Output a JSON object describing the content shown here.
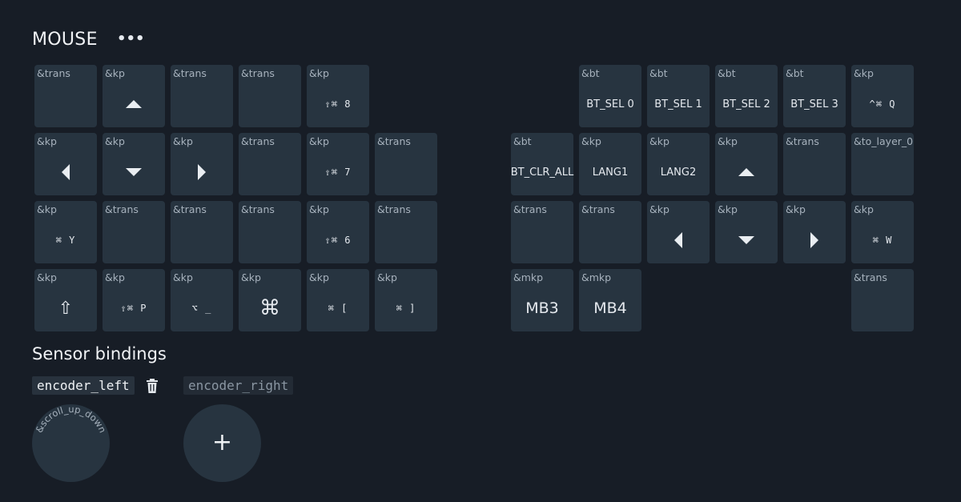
{
  "layer": {
    "name": "MOUSE",
    "menu_label": "•••"
  },
  "keys": [
    {
      "behavior": "&trans",
      "param": ""
    },
    {
      "behavior": "&kp",
      "param": "",
      "icon": "arrow-up-icon"
    },
    {
      "behavior": "&trans",
      "param": ""
    },
    {
      "behavior": "&trans",
      "param": ""
    },
    {
      "behavior": "&kp",
      "param": "⇧⌘ 8",
      "style": "mono"
    },
    {
      "behavior": "&bt",
      "param": "BT_SEL 0",
      "style": "sm"
    },
    {
      "behavior": "&bt",
      "param": "BT_SEL 1",
      "style": "sm"
    },
    {
      "behavior": "&bt",
      "param": "BT_SEL 2",
      "style": "sm"
    },
    {
      "behavior": "&bt",
      "param": "BT_SEL 3",
      "style": "sm"
    },
    {
      "behavior": "&kp",
      "param": "^⌘ Q",
      "style": "mono"
    },
    {
      "behavior": "&kp",
      "param": "",
      "icon": "arrow-left-icon"
    },
    {
      "behavior": "&kp",
      "param": "",
      "icon": "arrow-down-icon"
    },
    {
      "behavior": "&kp",
      "param": "",
      "icon": "arrow-right-icon"
    },
    {
      "behavior": "&trans",
      "param": ""
    },
    {
      "behavior": "&kp",
      "param": "⇧⌘ 7",
      "style": "mono"
    },
    {
      "behavior": "&trans",
      "param": ""
    },
    {
      "behavior": "&bt",
      "param": "BT_CLR_ALL",
      "style": "sm"
    },
    {
      "behavior": "&kp",
      "param": "LANG1",
      "style": "sm"
    },
    {
      "behavior": "&kp",
      "param": "LANG2",
      "style": "sm"
    },
    {
      "behavior": "&kp",
      "param": "",
      "icon": "arrow-up-icon"
    },
    {
      "behavior": "&trans",
      "param": ""
    },
    {
      "behavior": "&to_layer_0",
      "param": ""
    },
    {
      "behavior": "&kp",
      "param": "⌘ Y",
      "style": "mono"
    },
    {
      "behavior": "&trans",
      "param": ""
    },
    {
      "behavior": "&trans",
      "param": ""
    },
    {
      "behavior": "&trans",
      "param": ""
    },
    {
      "behavior": "&kp",
      "param": "⇧⌘ 6",
      "style": "mono"
    },
    {
      "behavior": "&trans",
      "param": ""
    },
    {
      "behavior": "&trans",
      "param": ""
    },
    {
      "behavior": "&trans",
      "param": ""
    },
    {
      "behavior": "&kp",
      "param": "",
      "icon": "arrow-left-icon"
    },
    {
      "behavior": "&kp",
      "param": "",
      "icon": "arrow-down-icon"
    },
    {
      "behavior": "&kp",
      "param": "",
      "icon": "arrow-right-icon"
    },
    {
      "behavior": "&kp",
      "param": "⌘ W",
      "style": "mono"
    },
    {
      "behavior": "&kp",
      "param": "⇧",
      "style": "gly"
    },
    {
      "behavior": "&kp",
      "param": "⇧⌘ P",
      "style": "mono"
    },
    {
      "behavior": "&kp",
      "param": "⌥ _",
      "style": "mono"
    },
    {
      "behavior": "&kp",
      "param": "⌘",
      "style": "xl"
    },
    {
      "behavior": "&kp",
      "param": "⌘ [",
      "style": "mono"
    },
    {
      "behavior": "&kp",
      "param": "⌘ ]",
      "style": "mono"
    },
    {
      "behavior": "&mkp",
      "param": "MB3",
      "style": "lg"
    },
    {
      "behavior": "&mkp",
      "param": "MB4",
      "style": "lg"
    },
    {
      "behavior": "&trans",
      "param": ""
    }
  ],
  "sensor": {
    "title": "Sensor bindings",
    "tabs": [
      "encoder_left",
      "encoder_right"
    ],
    "knob_label": "&scroll_up_down",
    "add_label": "+"
  },
  "colors": {
    "background": "#171d26",
    "key": "#273440",
    "text": "#e5e9ee",
    "muted": "#a7b2bd"
  }
}
